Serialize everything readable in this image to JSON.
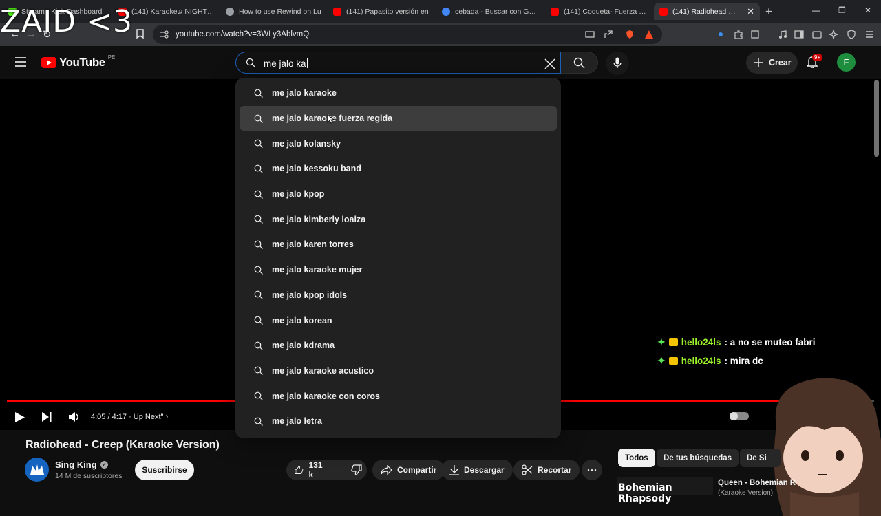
{
  "browser": {
    "tabs": [
      {
        "title": "Stream - Kick Dashboard",
        "icon": "kick-icon",
        "color": "#53fc18",
        "active": false
      },
      {
        "title": "(141) Karaoke♫ NIGHT DA",
        "icon": "youtube-icon",
        "color": "#ff0000",
        "active": false
      },
      {
        "title": "How to use Rewind on Lu",
        "icon": "page-icon",
        "color": "#9aa0a6",
        "active": false
      },
      {
        "title": "(141) Papasito versión en",
        "icon": "youtube-icon",
        "color": "#ff0000",
        "active": false
      },
      {
        "title": "cebada - Buscar con Goog",
        "icon": "google-icon",
        "color": "#4285f4",
        "active": false
      },
      {
        "title": "(141) Coqueta- Fuerza Reg",
        "icon": "youtube-icon",
        "color": "#ff0000",
        "active": false
      },
      {
        "title": "(141) Radiohead - Cre",
        "icon": "youtube-icon",
        "color": "#ff0000",
        "active": true
      }
    ],
    "url": "youtube.com/watch?v=3WLy3AblvmQ",
    "stream_overlay_text": "ZAID <3"
  },
  "header": {
    "logo_text": "YouTube",
    "country_code": "PE",
    "search_value": "me jalo ka",
    "create_label": "Crear",
    "notifications_badge": "9+",
    "avatar_letter": "F"
  },
  "suggestions": [
    "me jalo karaoke",
    "me jalo karaoke fuerza regida",
    "me jalo kolansky",
    "me jalo kessoku band",
    "me jalo kpop",
    "me jalo kimberly loaiza",
    "me jalo karen torres",
    "me jalo karaoke mujer",
    "me jalo kpop idols",
    "me jalo korean",
    "me jalo kdrama",
    "me jalo karaoke acustico",
    "me jalo karaoke con coros",
    "me jalo letra"
  ],
  "player": {
    "time": "4:05 / 4:17",
    "up_next": "· Up Next\"",
    "progress": 0.98,
    "chat": [
      {
        "user": "hello24ls",
        "message": ": a no se muteo fabri"
      },
      {
        "user": "hello24ls",
        "message": ": mira dc"
      }
    ]
  },
  "video": {
    "title": "Radiohead - Creep (Karaoke Version)",
    "channel": "Sing King",
    "subscribers": "14 M de suscriptores",
    "subscribe_label": "Suscribirse",
    "likes": "131 k",
    "share_label": "Compartir",
    "download_label": "Descargar",
    "clip_label": "Recortar"
  },
  "sidebar": {
    "chips": [
      "Todos",
      "De tus búsquedas",
      "De Si"
    ],
    "recommendation": {
      "thumb_text": "Bohemian Rhapsody",
      "title": "Queen - Bohemian R",
      "subtitle": "(Karaoke Version)"
    }
  }
}
